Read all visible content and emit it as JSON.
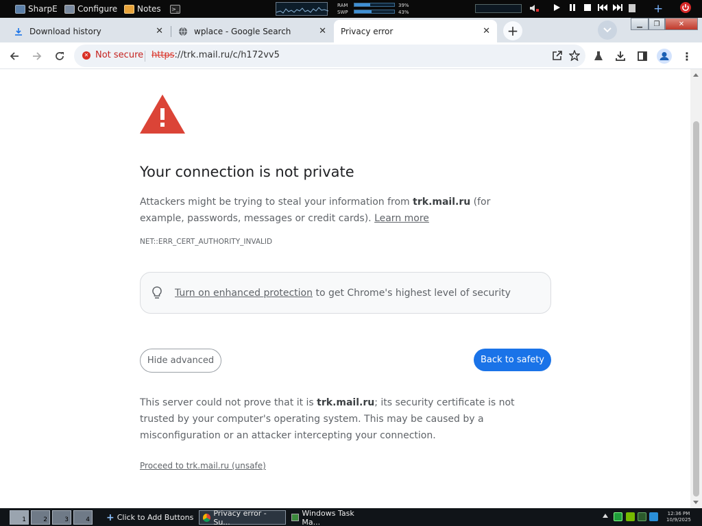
{
  "topbar": {
    "launchers": [
      {
        "label": "SharpE",
        "icon": "monitor-icon"
      },
      {
        "label": "Configure",
        "icon": "configure-icon"
      },
      {
        "label": "Notes",
        "icon": "notes-icon"
      }
    ],
    "terminal_icon": "terminal-icon",
    "ram_label": "RAM",
    "swp_label": "SWP",
    "ram_value": "39%",
    "swp_value": "43%",
    "ram_fraction": 0.39,
    "swp_fraction": 0.43
  },
  "tabs": [
    {
      "label": "Download history",
      "icon": "download-icon",
      "active": false
    },
    {
      "label": "wplace - Google Search",
      "icon": "globe-icon",
      "active": false
    },
    {
      "label": "Privacy error",
      "icon": "",
      "active": true
    }
  ],
  "toolbar": {
    "security_label": "Not secure",
    "url_scheme": "https",
    "url_rest": "://trk.mail.ru/c/h172vv5"
  },
  "page": {
    "heading": "Your connection is not private",
    "desc_prefix": "Attackers might be trying to steal your information from ",
    "domain": "trk.mail.ru",
    "desc_suffix": " (for example, passwords, messages or credit cards). ",
    "learn_more": "Learn more",
    "error_code": "NET::ERR_CERT_AUTHORITY_INVALID",
    "enhanced_link": "Turn on enhanced protection",
    "enhanced_suffix": " to get Chrome's highest level of security",
    "hide_advanced": "Hide advanced",
    "back_to_safety": "Back to safety",
    "details_prefix": "This server could not prove that it is ",
    "details_suffix": "; its security certificate is not trusted by your computer's operating system. This may be caused by a misconfiguration or an attacker intercepting your connection.",
    "proceed_link": "Proceed to trk.mail.ru (unsafe)"
  },
  "taskbar": {
    "workspaces": [
      "1",
      "2",
      "3",
      "4"
    ],
    "add_buttons": "Click to Add Buttons",
    "tasks": [
      {
        "label": "Privacy error - Su...",
        "active": true
      },
      {
        "label": "Windows Task Ma...",
        "active": false
      }
    ],
    "clock_time": "12:36 PM",
    "clock_date": "10/9/2025"
  },
  "colors": {
    "accent_blue": "#1a73e8",
    "warning_red": "#db4437",
    "not_secure_red": "#c5221f"
  }
}
